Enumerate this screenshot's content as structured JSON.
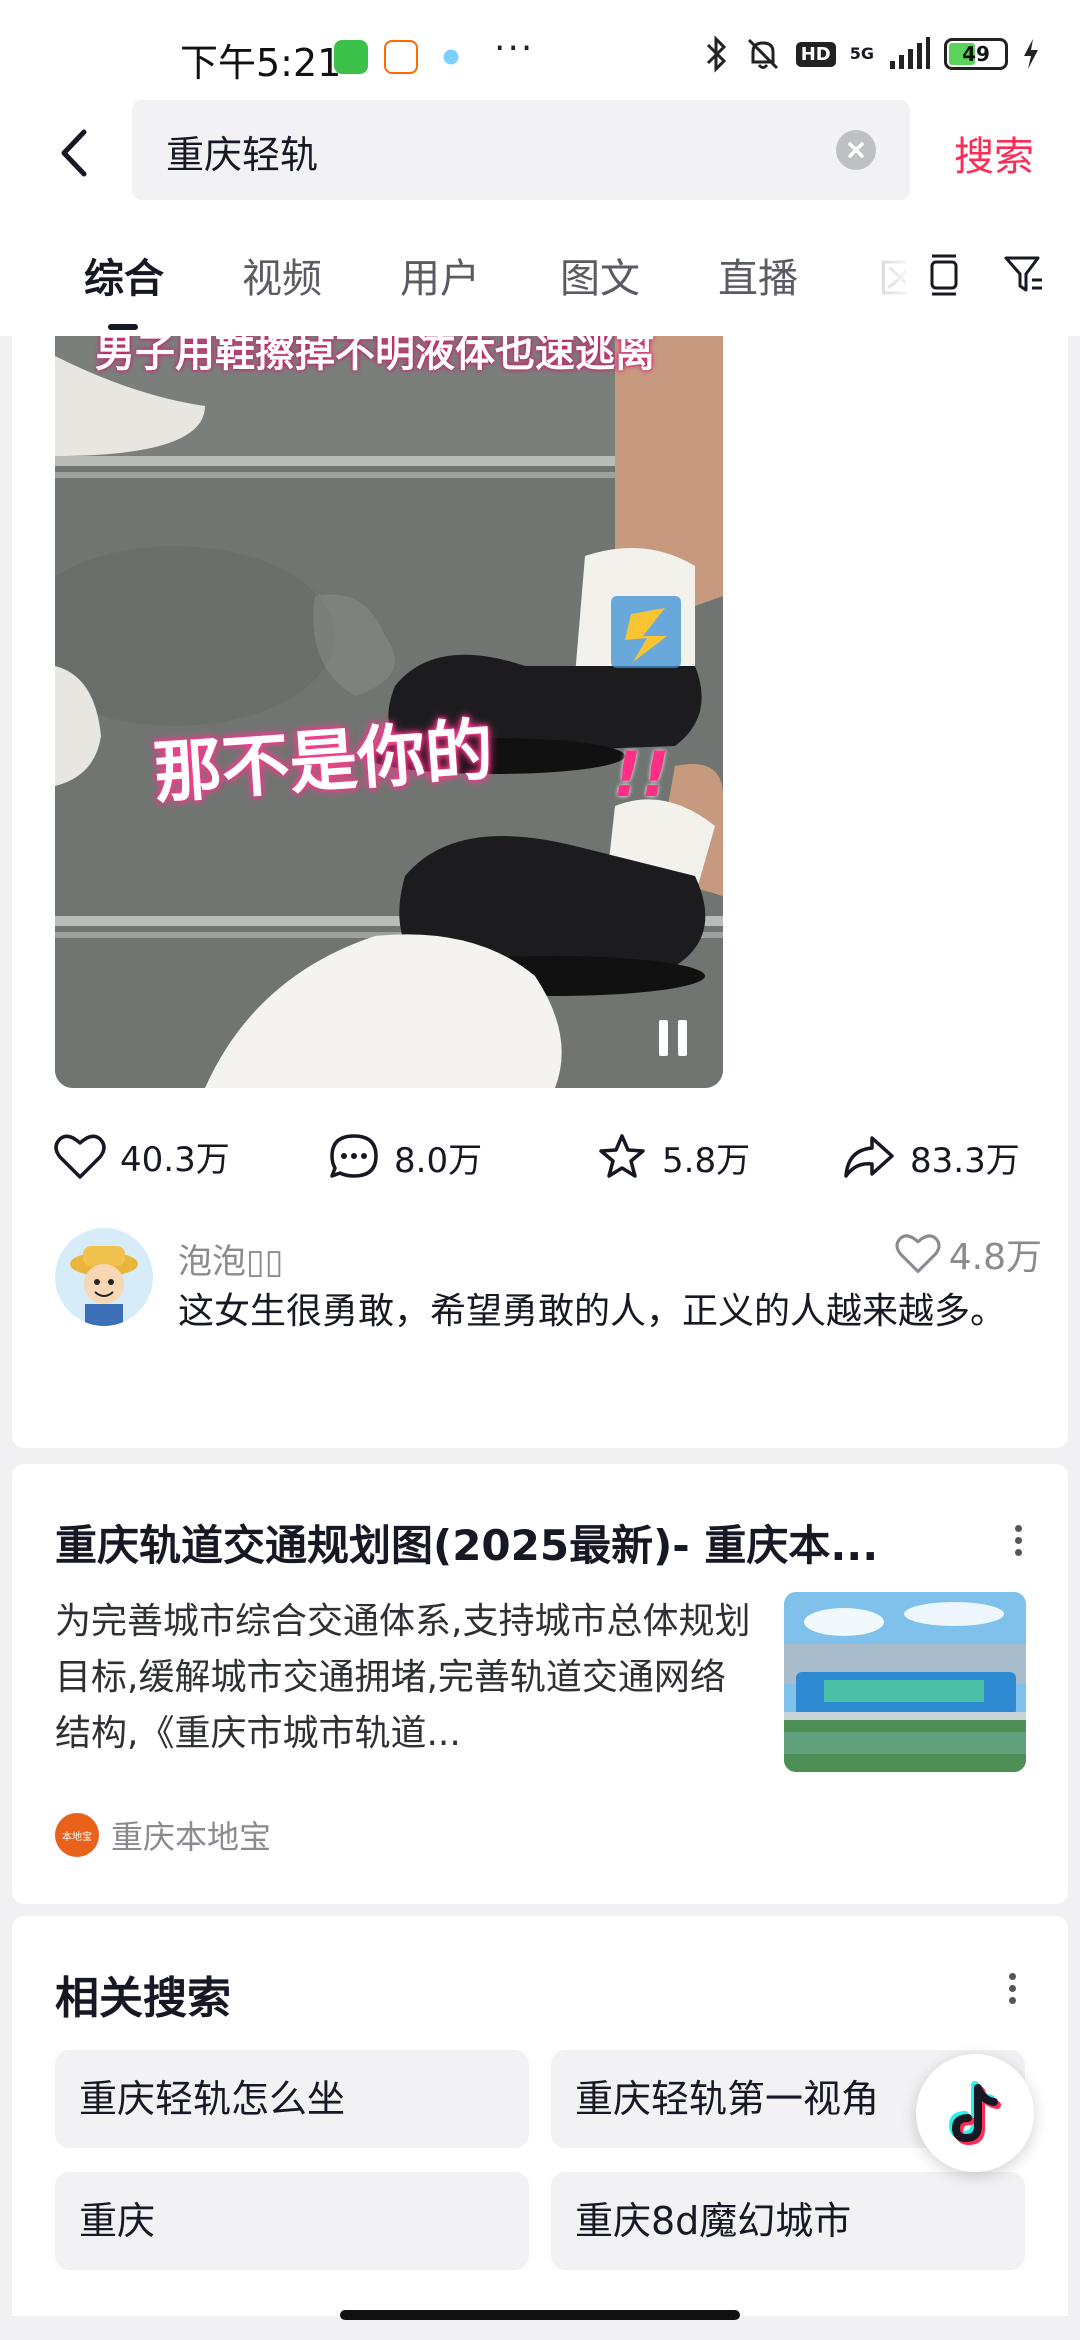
{
  "status_bar": {
    "time": "下午5:21",
    "more": "···",
    "battery_level": "49",
    "network": "5G",
    "hd_badge": "HD"
  },
  "header": {
    "query": "重庆轻轨",
    "search_button": "搜索"
  },
  "tabs": [
    {
      "label": "综合",
      "active": true
    },
    {
      "label": "视频",
      "active": false
    },
    {
      "label": "用户",
      "active": false
    },
    {
      "label": "图文",
      "active": false
    },
    {
      "label": "直播",
      "active": false
    },
    {
      "label": "区",
      "active": false
    }
  ],
  "video_card": {
    "overlay_title": "男子用鞋擦掉不明液体也速逃离",
    "overlay_sticker": "那不是你的",
    "overlay_exclaim": "!!",
    "likes": "40.3万",
    "comments": "8.0万",
    "favorites": "5.8万",
    "shares": "83.3万",
    "top_comment": {
      "user": "泡泡▯▯",
      "likes": "4.8万",
      "text": "这女生很勇敢，希望勇敢的人，正义的人越来越多。"
    }
  },
  "article_card": {
    "title": "重庆轨道交通规划图(2025最新)- 重庆本...",
    "description": "为完善城市综合交通体系,支持城市总体规划目标,缓解城市交通拥堵,完善轨道交通网络结构,《重庆市城市轨道...",
    "source": "重庆本地宝"
  },
  "related": {
    "title": "相关搜索",
    "items": [
      "重庆轻轨怎么坐",
      "重庆轻轨第一视角",
      "重庆",
      "重庆8d魔幻城市"
    ]
  },
  "colors": {
    "accent": "#fe2c55",
    "background": "#f1f1f3",
    "text_primary": "#161823",
    "text_secondary": "#8a8b91"
  }
}
